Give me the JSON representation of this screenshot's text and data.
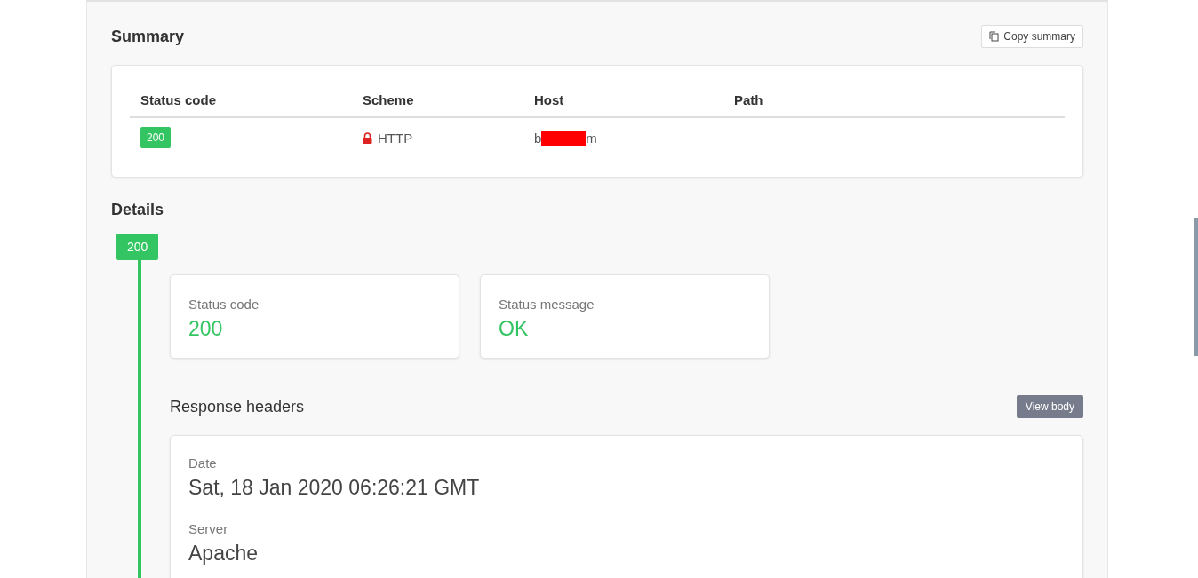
{
  "summary": {
    "title": "Summary",
    "copy_button": "Copy summary",
    "columns": [
      "Status code",
      "Scheme",
      "Host",
      "Path"
    ],
    "row": {
      "status_code": "200",
      "scheme": "HTTP",
      "scheme_secure": false,
      "host_start": "b",
      "host_redacted": true,
      "host_end": "m"
    }
  },
  "details": {
    "title": "Details",
    "step_badge": "200",
    "stats": [
      {
        "label": "Status code",
        "value": "200"
      },
      {
        "label": "Status message",
        "value": "OK"
      }
    ],
    "headers_title": "Response headers",
    "view_body_button": "View body",
    "headers": [
      {
        "name": "Date",
        "value": "Sat, 18 Jan 2020 06:26:21 GMT"
      },
      {
        "name": "Server",
        "value": "Apache"
      }
    ]
  }
}
